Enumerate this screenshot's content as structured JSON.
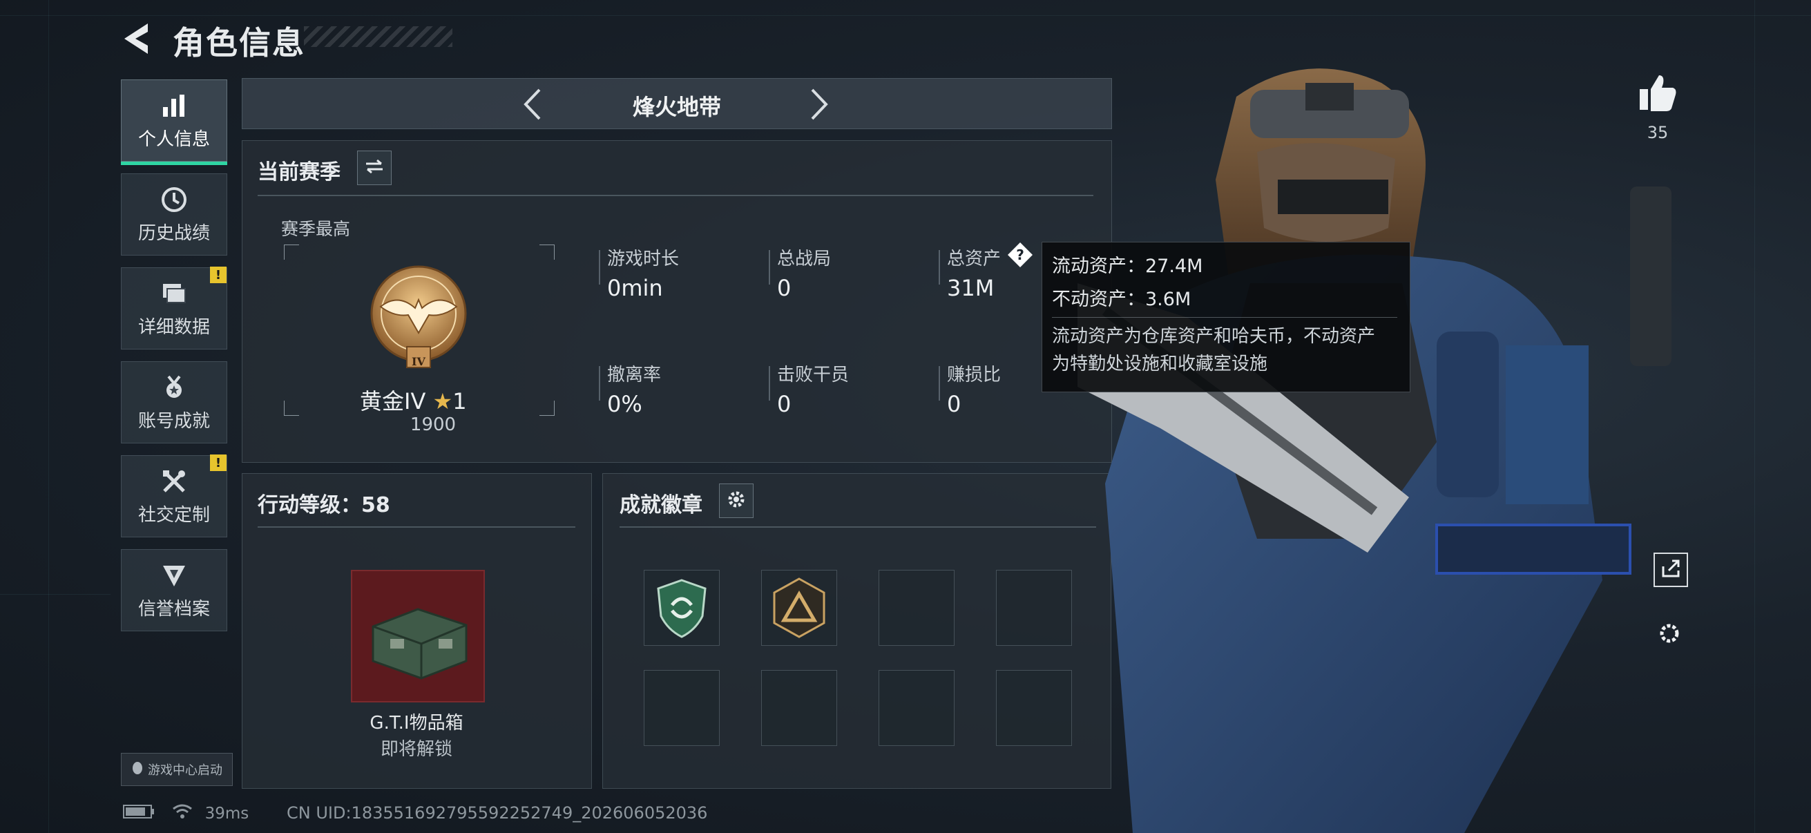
{
  "header": {
    "title": "角色信息"
  },
  "nav": {
    "items": [
      {
        "label": "个人信息",
        "icon": "bar-chart-icon",
        "active": true,
        "alert": false
      },
      {
        "label": "历史战绩",
        "icon": "clock-icon",
        "active": false,
        "alert": false
      },
      {
        "label": "详细数据",
        "icon": "folder-stack-icon",
        "active": false,
        "alert": true
      },
      {
        "label": "账号成就",
        "icon": "medal-icon",
        "active": false,
        "alert": false
      },
      {
        "label": "社交定制",
        "icon": "tools-icon",
        "active": false,
        "alert": true
      },
      {
        "label": "信誉档案",
        "icon": "credit-shield-icon",
        "active": false,
        "alert": false
      }
    ],
    "alert_mark": "!",
    "game_center_label": "游戏中心启动"
  },
  "mode": {
    "name": "烽火地带"
  },
  "season": {
    "title": "当前赛季",
    "best_label": "赛季最高",
    "rank_name": "黄金IV",
    "rank_stars": "1",
    "rank_points": "1900",
    "rank_numeral": "IV",
    "stats": [
      {
        "label": "游戏时长",
        "value": "0min"
      },
      {
        "label": "总战局",
        "value": "0"
      },
      {
        "label": "总资产",
        "value": "31M"
      },
      {
        "label": "撤离率",
        "value": "0%"
      },
      {
        "label": "击败干员",
        "value": "0"
      },
      {
        "label": "赚损比",
        "value": "0"
      }
    ]
  },
  "tooltip": {
    "liquid": "流动资产：27.4M",
    "fixed": "不动资产：3.6M",
    "desc_1": "流动资产为仓库资产和哈夫币，不动资产",
    "desc_2": "为特勤处设施和收藏室设施"
  },
  "level": {
    "title": "行动等级：58",
    "reward_name": "G.T.I物品箱",
    "reward_status": "即将解锁"
  },
  "badges": {
    "title": "成就徽章",
    "slots": [
      {
        "icon": "green-shield-badge-icon",
        "filled": true
      },
      {
        "icon": "gold-triangle-badge-icon",
        "filled": true
      },
      {
        "icon": "",
        "filled": false
      },
      {
        "icon": "",
        "filled": false
      },
      {
        "icon": "",
        "filled": false
      },
      {
        "icon": "",
        "filled": false
      },
      {
        "icon": "",
        "filled": false
      },
      {
        "icon": "",
        "filled": false
      }
    ]
  },
  "social": {
    "like_count": "35"
  },
  "status": {
    "ping": "39ms",
    "uid": "CN UID:183551692795592252749_202606052036"
  },
  "colors": {
    "accent": "#2fd5a3",
    "alert": "#e7c42d",
    "reward_bg": "#5c1a1e"
  }
}
